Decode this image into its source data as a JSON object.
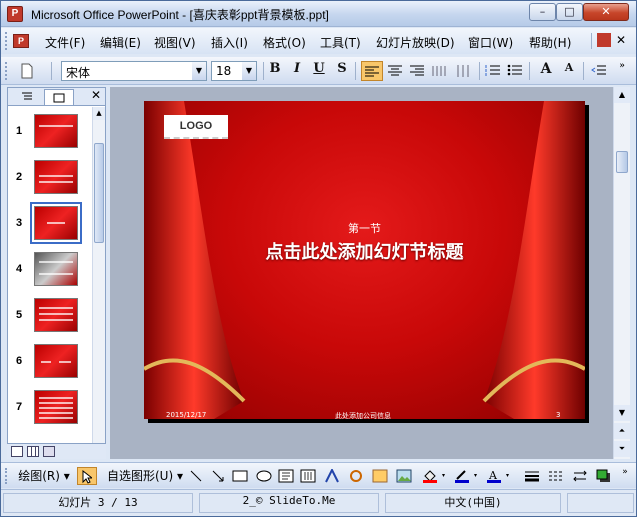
{
  "window": {
    "title": "Microsoft Office PowerPoint - [喜庆表彰ppt背景模板.ppt]",
    "app_icon": "P",
    "min_glyph": "–",
    "max_glyph": "□",
    "close_glyph": "✕"
  },
  "menu": {
    "items": [
      "文件(F)",
      "编辑(E)",
      "视图(V)",
      "插入(I)",
      "格式(O)",
      "工具(T)",
      "幻灯片放映(D)",
      "窗口(W)",
      "帮助(H)"
    ]
  },
  "toolbar": {
    "font_name": "宋体",
    "font_size": "18",
    "bold": "B",
    "italic": "I",
    "underline": "U",
    "shadow": "S",
    "grow_font": "A",
    "shrink_font": "A",
    "active_align": "left"
  },
  "outline_panel": {
    "tab_outline_icon": "outline-icon",
    "tab_slides_icon": "slides-icon",
    "close": "✕",
    "thumbnails": [
      {
        "number": "1"
      },
      {
        "number": "2"
      },
      {
        "number": "3",
        "selected": true
      },
      {
        "number": "4"
      },
      {
        "number": "5"
      },
      {
        "number": "6"
      },
      {
        "number": "7"
      }
    ]
  },
  "slide": {
    "logo": "LOGO",
    "section": "第一节",
    "title": "点击此处添加幻灯节标题",
    "date": "2015/12/17",
    "footer": "此处添加公司信息",
    "page": "3",
    "bg_color": "#c80808"
  },
  "drawing_toolbar": {
    "draw_menu": "绘图(R)",
    "autoshapes": "自选图形(U)"
  },
  "status": {
    "slide_info": "幻灯片 3 / 13",
    "design": "2_© SlideTo.Me",
    "language": "中文(中国)"
  }
}
